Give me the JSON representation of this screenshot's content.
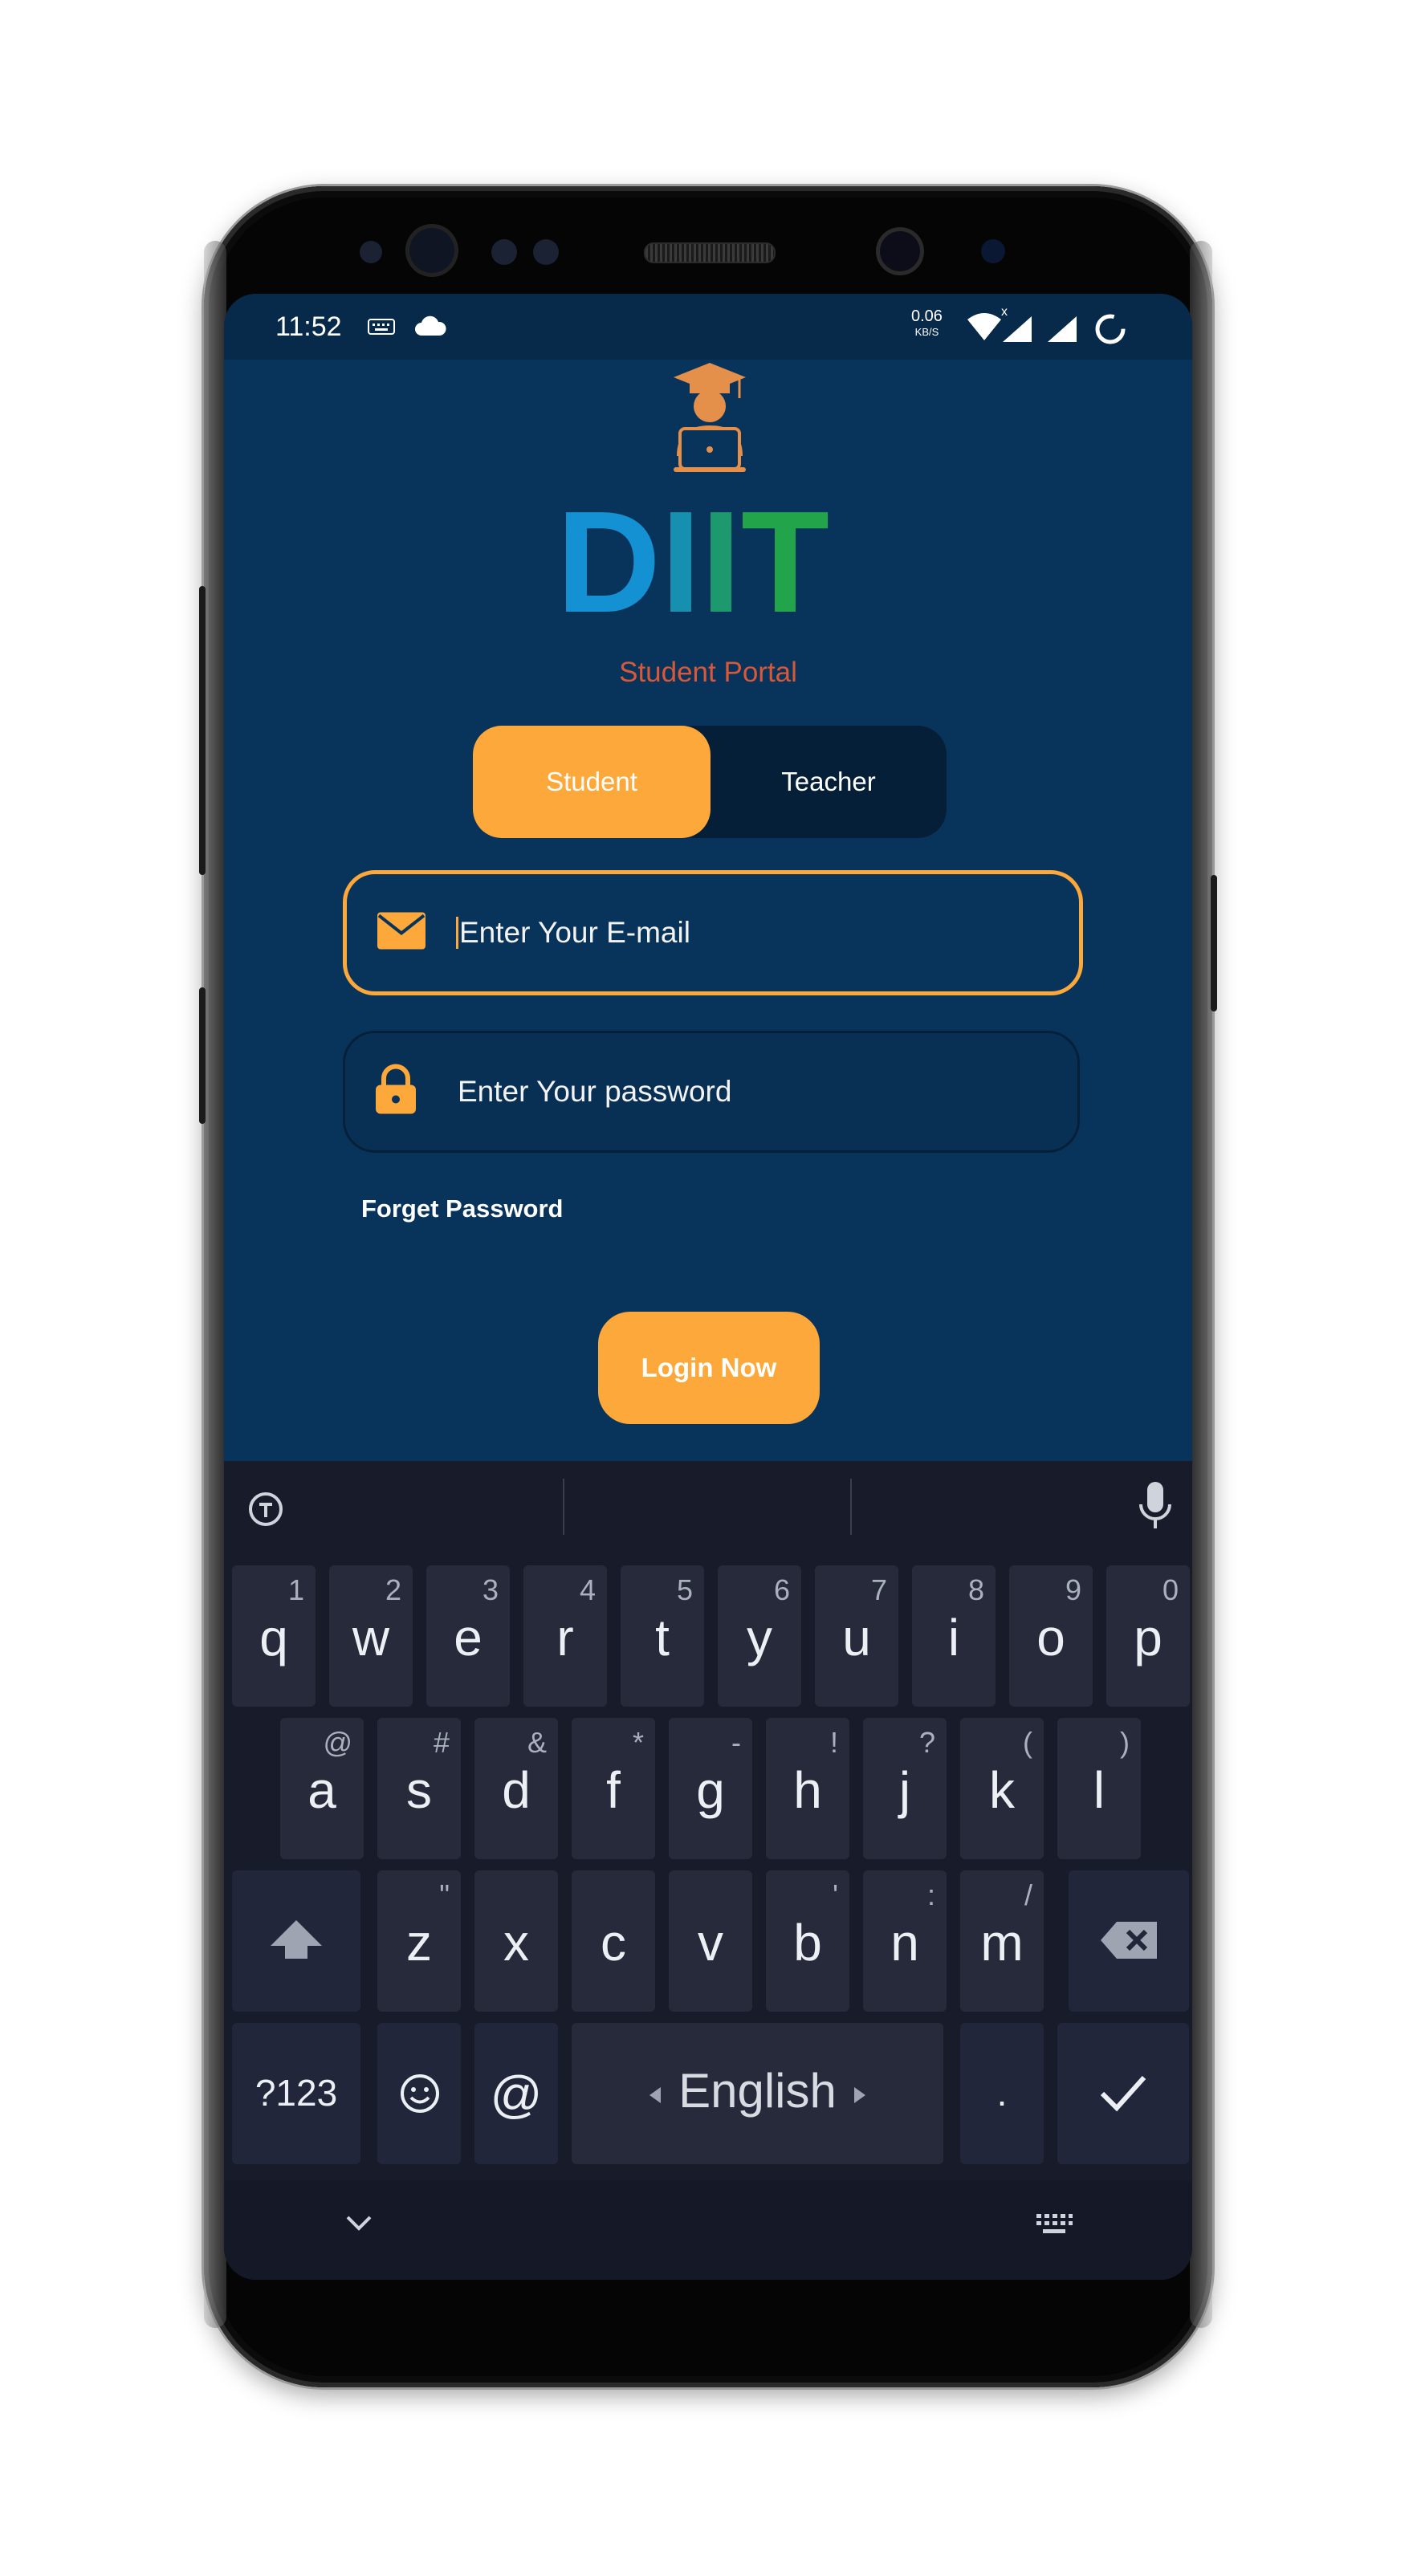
{
  "status_bar": {
    "time": "11:52",
    "net_speed": "0.06",
    "net_unit": "KB/S",
    "signal_x": "x"
  },
  "logo": {
    "brand": "DIIT",
    "subtitle": "Student Portal"
  },
  "role_toggle": {
    "student": "Student",
    "teacher": "Teacher",
    "selected": "Student"
  },
  "email_field": {
    "placeholder": "Enter Your E-mail"
  },
  "password_field": {
    "placeholder": "Enter Your password"
  },
  "forget_password": "Forget Password",
  "login_button": "Login Now",
  "keyboard": {
    "row1": [
      {
        "k": "q",
        "h": "1"
      },
      {
        "k": "w",
        "h": "2"
      },
      {
        "k": "e",
        "h": "3"
      },
      {
        "k": "r",
        "h": "4"
      },
      {
        "k": "t",
        "h": "5"
      },
      {
        "k": "y",
        "h": "6"
      },
      {
        "k": "u",
        "h": "7"
      },
      {
        "k": "i",
        "h": "8"
      },
      {
        "k": "o",
        "h": "9"
      },
      {
        "k": "p",
        "h": "0"
      }
    ],
    "row2": [
      {
        "k": "a",
        "h": "@"
      },
      {
        "k": "s",
        "h": "#"
      },
      {
        "k": "d",
        "h": "&"
      },
      {
        "k": "f",
        "h": "*"
      },
      {
        "k": "g",
        "h": "-"
      },
      {
        "k": "h",
        "h": "!"
      },
      {
        "k": "j",
        "h": "?"
      },
      {
        "k": "k",
        "h": "("
      },
      {
        "k": "l",
        "h": ")"
      }
    ],
    "row3": [
      {
        "k": "z",
        "h": "\""
      },
      {
        "k": "x",
        "h": ""
      },
      {
        "k": "c",
        "h": ""
      },
      {
        "k": "v",
        "h": ""
      },
      {
        "k": "b",
        "h": "'"
      },
      {
        "k": "n",
        "h": ":"
      },
      {
        "k": "m",
        "h": "/"
      }
    ],
    "symbols_key": "?123",
    "at_key": "@",
    "space_label": "English",
    "period_key": "."
  },
  "icons": [
    "keyboard-icon",
    "cloud-icon",
    "wifi-icon",
    "signal-icon",
    "battery-icon",
    "graduate-icon",
    "mail-icon",
    "lock-icon",
    "clipboard-icon",
    "mic-icon",
    "shift-icon",
    "backspace-icon",
    "emoji-icon",
    "check-icon",
    "chevron-down-icon",
    "keyboard-hide-icon"
  ],
  "colors": {
    "bg": "#08335a",
    "accent": "#fca83a",
    "keyboard": "#171b2a"
  }
}
